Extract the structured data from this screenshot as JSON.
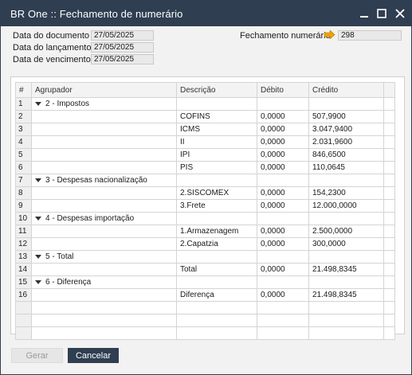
{
  "window": {
    "title": "BR One :: Fechamento de numerário"
  },
  "header": {
    "data_documento_label": "Data do documento",
    "data_documento_value": "27/05/2025",
    "data_lancamento_label": "Data do lançamento",
    "data_lancamento_value": "27/05/2025",
    "data_vencimento_label": "Data de vencimento",
    "data_vencimento_value": "27/05/2025",
    "fechamento_label": "Fechamento numerário",
    "fechamento_value": "298"
  },
  "grid": {
    "columns": [
      "#",
      "Agrupador",
      "Descrição",
      "Débito",
      "Crédito"
    ],
    "rows": [
      {
        "n": "1",
        "group": "2 - Impostos",
        "desc": "",
        "debito": "",
        "credito": ""
      },
      {
        "n": "2",
        "group": "",
        "desc": "COFINS",
        "debito": "0,0000",
        "credito": "507,9900"
      },
      {
        "n": "3",
        "group": "",
        "desc": "ICMS",
        "debito": "0,0000",
        "credito": "3.047,9400"
      },
      {
        "n": "4",
        "group": "",
        "desc": "II",
        "debito": "0,0000",
        "credito": "2.031,9600"
      },
      {
        "n": "5",
        "group": "",
        "desc": "IPI",
        "debito": "0,0000",
        "credito": "846,6500"
      },
      {
        "n": "6",
        "group": "",
        "desc": "PIS",
        "debito": "0,0000",
        "credito": "110,0645"
      },
      {
        "n": "7",
        "group": "3 - Despesas nacionalização",
        "desc": "",
        "debito": "",
        "credito": ""
      },
      {
        "n": "8",
        "group": "",
        "desc": "2.SISCOMEX",
        "debito": "0,0000",
        "credito": "154,2300"
      },
      {
        "n": "9",
        "group": "",
        "desc": "3.Frete",
        "debito": "0,0000",
        "credito": "12.000,0000"
      },
      {
        "n": "10",
        "group": "4 - Despesas importação",
        "desc": "",
        "debito": "",
        "credito": ""
      },
      {
        "n": "11",
        "group": "",
        "desc": "1.Armazenagem",
        "debito": "0,0000",
        "credito": "2.500,0000"
      },
      {
        "n": "12",
        "group": "",
        "desc": "2.Capatzia",
        "debito": "0,0000",
        "credito": "300,0000"
      },
      {
        "n": "13",
        "group": "5 - Total",
        "desc": "",
        "debito": "",
        "credito": ""
      },
      {
        "n": "14",
        "group": "",
        "desc": "Total",
        "debito": "0,0000",
        "credito": "21.498,8345"
      },
      {
        "n": "15",
        "group": "6 - Diferença",
        "desc": "",
        "debito": "",
        "credito": ""
      },
      {
        "n": "16",
        "group": "",
        "desc": "Diferença",
        "debito": "0,0000",
        "credito": "21.498,8345"
      }
    ]
  },
  "buttons": {
    "gerar": "Gerar",
    "cancelar": "Cancelar"
  },
  "colors": {
    "titlebar": "#2f3e51",
    "arrow": "#f0a000"
  }
}
